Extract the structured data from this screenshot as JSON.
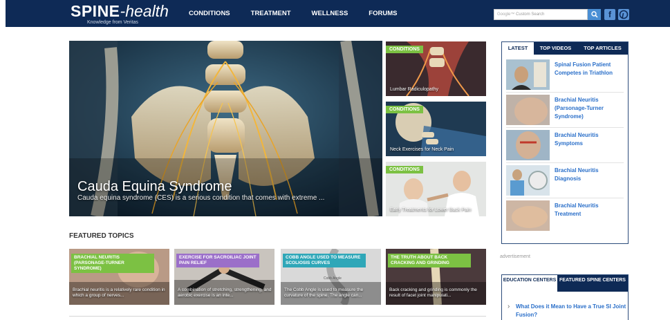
{
  "header": {
    "logo": {
      "main": "SPINE",
      "accent": "-health",
      "tagline": "Knowledge from Veritas"
    },
    "nav": [
      "CONDITIONS",
      "TREATMENT",
      "WELLNESS",
      "FORUMS"
    ],
    "search": {
      "placeholder": "Custom Search",
      "google_label": "Google™"
    },
    "social": [
      "facebook-icon",
      "pinterest-icon"
    ]
  },
  "hero": {
    "title": "Cauda Equina Syndrome",
    "subtitle": "Cauda equina syndrome (CES) is a serious condition that comes with extreme ..."
  },
  "side_cards": [
    {
      "tag": "CONDITIONS",
      "caption": "Lumbar Radiculopathy"
    },
    {
      "tag": "CONDITIONS",
      "caption": "Neck Exercises for Neck Pain"
    },
    {
      "tag": "CONDITIONS",
      "caption": "Early Treatments for Lower Back Pain"
    }
  ],
  "featured": {
    "heading": "FEATURED TOPICS",
    "topics": [
      {
        "tag": "BRACHIAL NEURITIS (PARSONAGE-TURNER SYNDROME)",
        "tag_color": "#7cc143",
        "desc": "Brachial neuritis is a relatively rare condition in which a group of nerves..."
      },
      {
        "tag": "EXERCISE FOR SACROILIAC JOINT PAIN RELIEF",
        "tag_color": "#9b6fc9",
        "desc": "A combination of stretching, strengthening, and aerobic exercise is an inte..."
      },
      {
        "tag": "COBB ANGLE USED TO MEASURE SCOLIOSIS CURVES",
        "tag_color": "#2fa7b8",
        "desc": "The Cobb Angle is used to measure the curvature of the spine. The angle can..."
      },
      {
        "tag": "THE TRUTH ABOUT BACK CRACKING AND GRINDING",
        "tag_color": "#7cc143",
        "desc": "Back cracking and grinding is commonly the result of facet joint manipulati..."
      }
    ]
  },
  "sidebar": {
    "tabs": [
      "LATEST",
      "TOP VIDEOS",
      "TOP ARTICLES"
    ],
    "articles": [
      "Spinal Fusion Patient Competes in Triathlon",
      "Brachial Neuritis (Parsonage-Turner Syndrome)",
      "Brachial Neuritis Symptoms",
      "Brachial Neuritis Diagnosis",
      "Brachial Neuritis Treatment"
    ],
    "advertisement": "advertisement",
    "edu_tabs": [
      "EDUCATION CENTERS",
      "FEATURED SPINE CENTERS"
    ],
    "edu_link": "What Does it Mean to Have a True SI Joint Fusion?"
  },
  "colors": {
    "navy": "#0e2a56",
    "green": "#7cc143",
    "link": "#2a6fc9"
  }
}
